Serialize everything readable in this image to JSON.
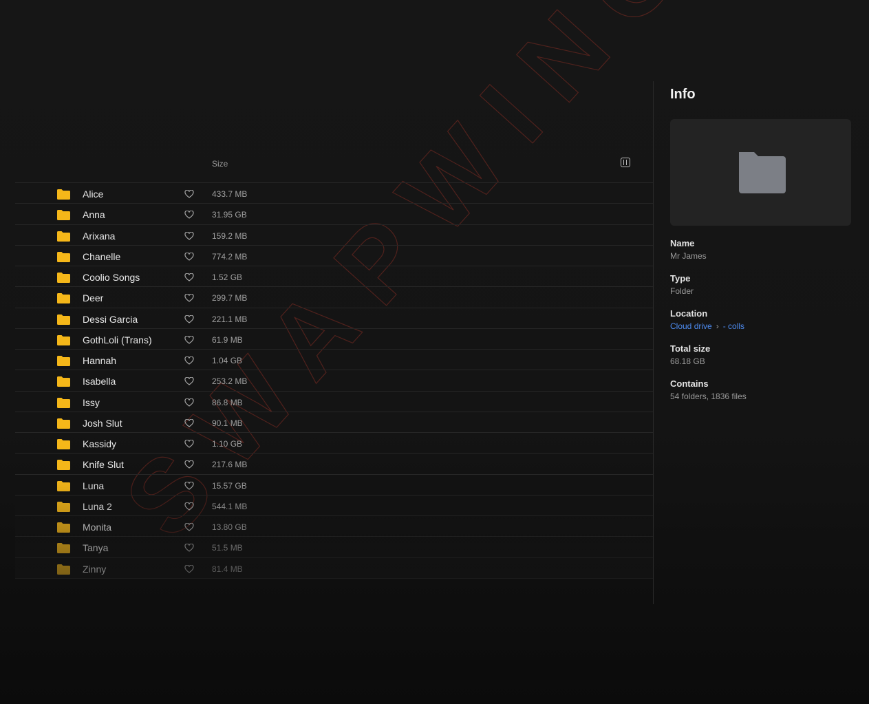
{
  "list": {
    "size_header": "Size",
    "columns_icon": "columns-icon",
    "items": [
      {
        "name": "Alice",
        "size": "433.7 MB"
      },
      {
        "name": "Anna",
        "size": "31.95 GB"
      },
      {
        "name": "Arixana",
        "size": "159.2 MB"
      },
      {
        "name": "Chanelle",
        "size": "774.2 MB"
      },
      {
        "name": "Coolio Songs",
        "size": "1.52 GB"
      },
      {
        "name": "Deer",
        "size": "299.7 MB"
      },
      {
        "name": "Dessi Garcia",
        "size": "221.1 MB"
      },
      {
        "name": "GothLoli (Trans)",
        "size": "61.9 MB"
      },
      {
        "name": "Hannah",
        "size": "1.04 GB"
      },
      {
        "name": "Isabella",
        "size": "253.2 MB"
      },
      {
        "name": "Issy",
        "size": "86.8 MB"
      },
      {
        "name": "Josh Slut",
        "size": "90.1 MB"
      },
      {
        "name": "Kassidy",
        "size": "1.10 GB"
      },
      {
        "name": "Knife Slut",
        "size": "217.6 MB"
      },
      {
        "name": "Luna",
        "size": "15.57 GB"
      },
      {
        "name": "Luna 2",
        "size": "544.1 MB"
      },
      {
        "name": "Monita",
        "size": "13.80 GB"
      },
      {
        "name": "Tanya",
        "size": "51.5 MB"
      },
      {
        "name": "Zinny",
        "size": "81.4 MB"
      }
    ]
  },
  "info": {
    "title": "Info",
    "name_label": "Name",
    "name_value": "Mr James",
    "type_label": "Type",
    "type_value": "Folder",
    "location_label": "Location",
    "location_root": "Cloud drive",
    "location_folder": "- colls",
    "total_size_label": "Total size",
    "total_size_value": "68.18 GB",
    "contains_label": "Contains",
    "contains_value": "54 folders, 1836 files"
  },
  "watermark": "SWAPWINGS",
  "colors": {
    "folder": "#f5b719",
    "accent_link": "#4d8bf0",
    "watermark": "#c0392b"
  }
}
